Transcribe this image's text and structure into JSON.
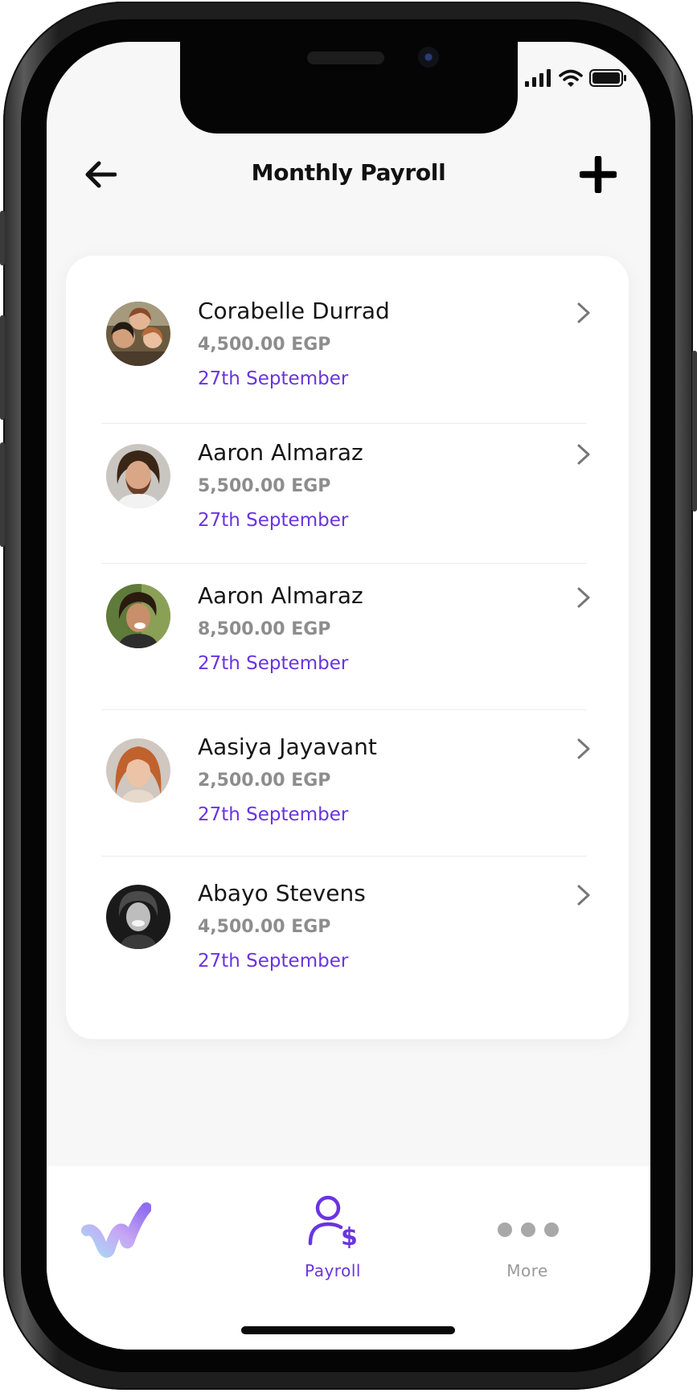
{
  "header": {
    "title": "Monthly Payroll"
  },
  "employees": [
    {
      "name": "Corabelle Durrad",
      "amount": "4,500.00 EGP",
      "date": "27th September"
    },
    {
      "name": "Aaron Almaraz",
      "amount": "5,500.00 EGP",
      "date": "27th September"
    },
    {
      "name": "Aaron Almaraz",
      "amount": "8,500.00 EGP",
      "date": "27th September"
    },
    {
      "name": "Aasiya Jayavant",
      "amount": "2,500.00 EGP",
      "date": "27th September"
    },
    {
      "name": "Abayo Stevens",
      "amount": "4,500.00 EGP",
      "date": "27th September"
    }
  ],
  "tabbar": {
    "items": [
      {
        "label": "",
        "icon": "brand-logo-icon"
      },
      {
        "label": "Payroll",
        "icon": "user-dollar-icon",
        "active": true
      },
      {
        "label": "More",
        "icon": "more-dots-icon"
      }
    ]
  },
  "colors": {
    "accent": "#6a34e0",
    "amount_gray": "#8d8d8d",
    "background": "#f7f7f7"
  }
}
